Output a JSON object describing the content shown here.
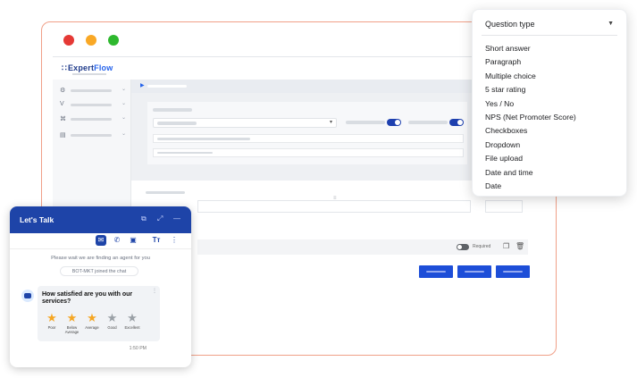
{
  "app": {
    "logo_text": "ExpertFlow",
    "logo_expert": "Expert",
    "logo_flow": "Flow"
  },
  "form_builder": {
    "required_label": "Required"
  },
  "question_type_menu": {
    "header": "Question type",
    "options": [
      "Short answer",
      "Paragraph",
      "Multiple choice",
      "5 star rating",
      "Yes / No",
      "NPS (Net Promoter Score)",
      "Checkboxes",
      "Dropdown",
      "File upload",
      "Date and time",
      "Date"
    ]
  },
  "chat": {
    "title": "Let's Talk",
    "waiting_text": "Please wait we are finding an agent for you",
    "joined_text": "BOT-MKT joined the chat",
    "question": "How satisfied are you with our services?",
    "rating": {
      "selected": 3,
      "max": 5,
      "labels": [
        "Poor",
        "Below Average",
        "Average",
        "Good",
        "Excellent"
      ]
    },
    "time": "1:50 PM"
  },
  "colors": {
    "brand_blue": "#1e44a8",
    "star_on": "#f5a623",
    "star_off": "#9aa0a6",
    "frame_border": "#f0a088"
  }
}
